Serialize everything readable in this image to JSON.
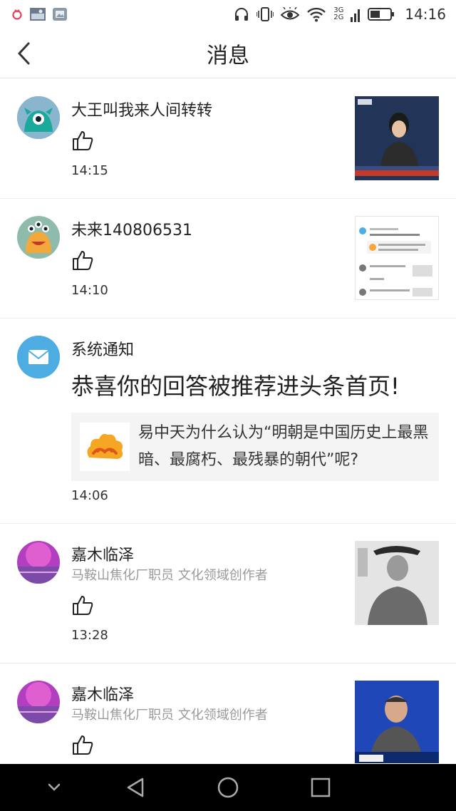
{
  "status_bar": {
    "time": "14:16",
    "network_top": "3G",
    "network_bottom": "2G"
  },
  "header": {
    "title": "消息"
  },
  "items": [
    {
      "name": "大王叫我来人间转转",
      "time": "14:15"
    },
    {
      "name": "未来140806531",
      "time": "14:10"
    },
    {
      "name": "系统通知",
      "headline": "恭喜你的回答被推荐进头条首页!",
      "card_text": "易中天为什么认为“明朝是中国历史上最黑暗、最腐朽、最残暴的朝代”呢?",
      "time": "14:06"
    },
    {
      "name": "嘉木临泽",
      "subtitle": "马鞍山焦化厂职员 文化领域创作者",
      "time": "13:28"
    },
    {
      "name": "嘉木临泽",
      "subtitle": "马鞍山焦化厂职员 文化领域创作者"
    }
  ],
  "colors": {
    "mail_avatar": "#4dade2",
    "monster1": "#1aa99b",
    "monster2": "#f3a83b",
    "navbar": "#000000"
  },
  "icons": [
    "back-icon",
    "like-icon",
    "mail-icon",
    "nav-back-icon",
    "nav-home-icon",
    "nav-recents-icon"
  ]
}
